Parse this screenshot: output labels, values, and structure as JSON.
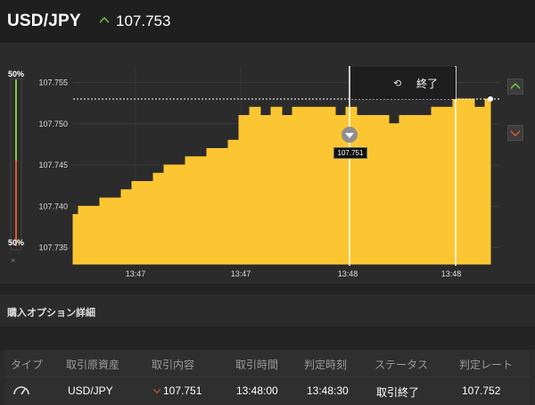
{
  "header": {
    "pair": "USD/JPY",
    "price": "107.753",
    "direction_icon": "arrow-up-icon",
    "up_color": "#7ac943"
  },
  "chart_data": {
    "type": "area",
    "xlabel": "",
    "ylabel": "",
    "ylim": [
      107.733,
      107.757
    ],
    "yticks": [
      "107.755",
      "107.750",
      "107.745",
      "107.740",
      "107.735"
    ],
    "xticks": [
      "13:47",
      "13:47",
      "13:48",
      "13:48"
    ],
    "current_price_line": 107.753,
    "entry_marker": {
      "value": 107.751,
      "label": "107.751"
    },
    "series": [
      {
        "values": [
          107.739,
          107.74,
          107.74,
          107.741,
          107.741,
          107.742,
          107.743,
          107.743,
          107.744,
          107.745,
          107.745,
          107.746,
          107.746,
          107.747,
          107.747,
          107.748,
          107.751,
          107.752,
          107.751,
          107.752,
          107.751,
          107.752,
          107.752,
          107.752,
          107.752,
          107.751,
          107.752,
          107.751,
          107.751,
          107.751,
          107.75,
          107.751,
          107.751,
          107.751,
          107.752,
          107.752,
          107.753,
          107.753,
          107.752,
          107.753
        ]
      }
    ],
    "fill_color": "#fcc632"
  },
  "ratio": {
    "top": "50%",
    "bottom": "50%",
    "close": "×",
    "top_color": "#7ac943",
    "bottom_color": "#e05a2b"
  },
  "end_banner": {
    "icon": "history-icon",
    "icon_glyph": "⟲",
    "label": "終了"
  },
  "side_buttons": {
    "up": "high-arrow-icon",
    "down": "low-arrow-icon",
    "down_color": "#e05a2b"
  },
  "details": {
    "title": "購入オプション詳細",
    "columns": [
      "タイプ",
      "取引原資産",
      "取引内容",
      "取引時間",
      "判定時刻",
      "ステータス",
      "判定レート"
    ],
    "rows": [
      {
        "type_icon": "gauge-icon",
        "asset": "USD/JPY",
        "content": "107.751",
        "content_icon": "arrow-down-icon",
        "time": "13:48:00",
        "judge_time": "13:48:30",
        "status": "取引終了",
        "rate": "107.752"
      }
    ]
  }
}
